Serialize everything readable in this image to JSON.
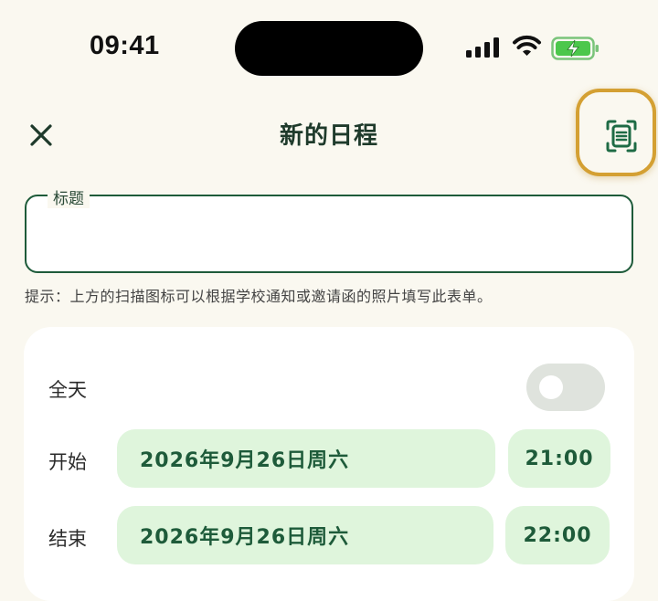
{
  "status_bar": {
    "time": "09:41"
  },
  "header": {
    "title": "新的日程"
  },
  "title_field": {
    "label": "标题",
    "value": ""
  },
  "hint": "提示：上方的扫描图标可以根据学校通知或邀请函的照片填写此表单。",
  "all_day": {
    "label": "全天",
    "enabled": false
  },
  "start": {
    "label": "开始",
    "date": "2026年9月26日周六",
    "time": "21:00"
  },
  "end": {
    "label": "结束",
    "date": "2026年9月26日周六",
    "time": "22:00"
  },
  "colors": {
    "accent": "#1e5b3a",
    "pill_bg": "#dff5dc",
    "highlight": "#d4a033",
    "background": "#faf8f0"
  },
  "icons": [
    "cellular-signal-icon",
    "wifi-icon",
    "battery-charging-icon",
    "close-icon",
    "document-scan-icon"
  ]
}
